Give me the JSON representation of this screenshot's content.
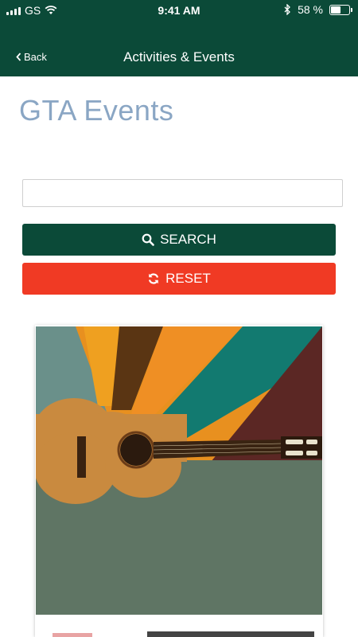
{
  "status_bar": {
    "carrier": "GS",
    "time": "9:41 AM",
    "battery_percent": "58 %",
    "battery_level": 0.58
  },
  "nav": {
    "back_label": "Back",
    "title": "Activities & Events"
  },
  "page": {
    "title": "GTA Events"
  },
  "search": {
    "value": "",
    "placeholder": "",
    "search_label": "SEARCH",
    "reset_label": "RESET"
  },
  "colors": {
    "header": "#0b4a38",
    "accent": "#f03a24",
    "title": "#8aa6c4"
  },
  "icons": [
    "signal-icon",
    "wifi-icon",
    "bluetooth-icon",
    "battery-icon",
    "back-chevron-icon",
    "search-icon",
    "refresh-icon"
  ]
}
